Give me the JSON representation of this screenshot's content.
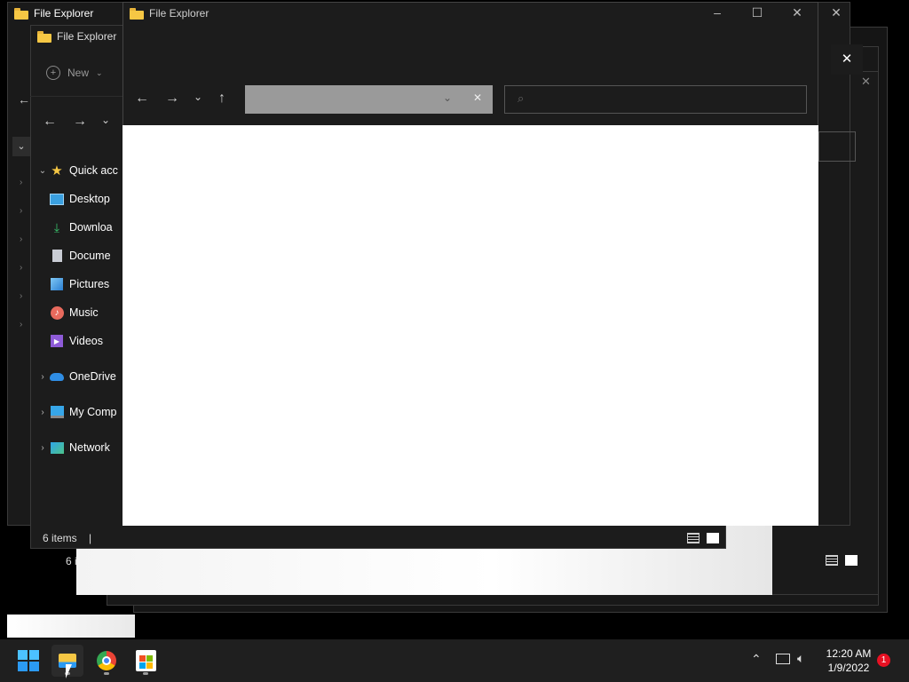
{
  "windows": {
    "back_title": "File Explorer",
    "mid_title": "File Explorer",
    "front_title": "File Explorer"
  },
  "toolbar": {
    "new_label": "New"
  },
  "sidebar": {
    "items": [
      {
        "label": "Quick acc",
        "icon": "star-icon"
      },
      {
        "label": "Desktop",
        "icon": "desktop-icon"
      },
      {
        "label": "Downloa",
        "icon": "download-icon"
      },
      {
        "label": "Docume",
        "icon": "document-icon"
      },
      {
        "label": "Pictures",
        "icon": "pictures-icon"
      },
      {
        "label": "Music",
        "icon": "music-icon"
      },
      {
        "label": "Videos",
        "icon": "videos-icon"
      },
      {
        "label": "OneDrive",
        "icon": "cloud-icon"
      },
      {
        "label": "My Comp",
        "icon": "computer-icon"
      },
      {
        "label": "Network",
        "icon": "network-icon"
      }
    ]
  },
  "status": {
    "items_count": "6 items",
    "back_items_count": "6 i"
  },
  "taskbar": {
    "time": "12:20 AM",
    "date": "1/9/2022",
    "notification_count": "1"
  },
  "colors": {
    "accent_blue": "#2b9af3",
    "folder_yellow": "#f6c744",
    "badge_red": "#e81123"
  }
}
